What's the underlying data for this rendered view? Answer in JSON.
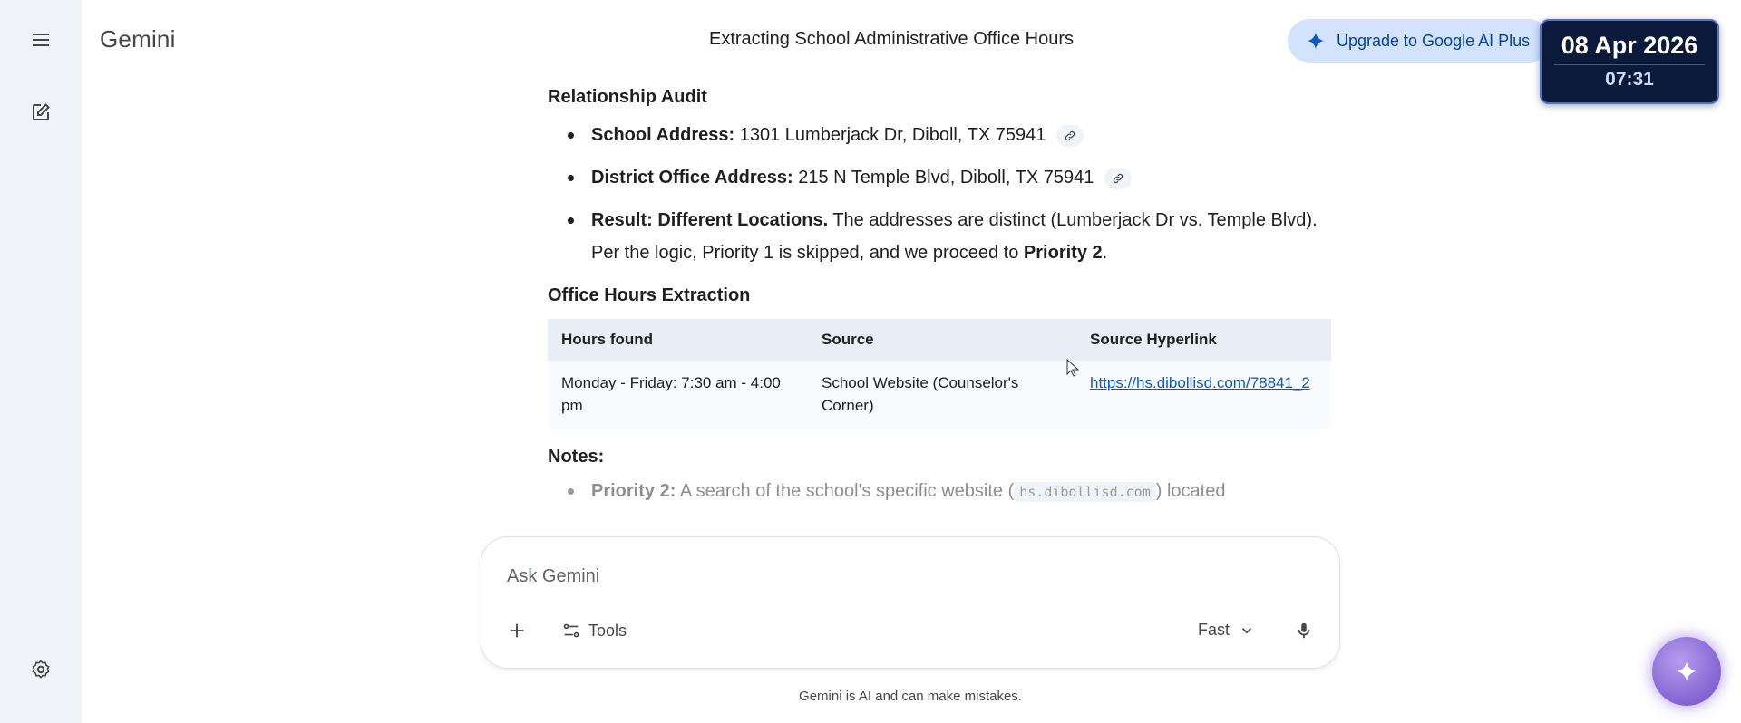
{
  "app": {
    "brand": "Gemini",
    "conversation_title": "Extracting School Administrative Office Hours"
  },
  "header": {
    "upgrade_label": "Upgrade to Google AI Plus"
  },
  "clock": {
    "date": "08 Apr 2026",
    "time": "07:31"
  },
  "sidebar": {
    "icons": [
      "menu-icon",
      "new-chat-icon",
      "settings-icon"
    ]
  },
  "relationship": {
    "heading": "Relationship Audit",
    "school_label": "School Address:",
    "school_value": "1301 Lumberjack Dr, Diboll, TX 75941",
    "district_label": "District Office Address:",
    "district_value": "215 N Temple Blvd, Diboll, TX 75941",
    "result_label": "Result: Different Locations.",
    "result_text": "The addresses are distinct (Lumberjack Dr vs. Temple Blvd). Per the logic, Priority 1 is skipped, and we proceed to",
    "result_emph": "Priority 2",
    "result_end": "."
  },
  "extraction": {
    "heading": "Office Hours Extraction",
    "columns": [
      "Hours found",
      "Source",
      "Source Hyperlink"
    ],
    "rows": [
      [
        "Monday - Friday: 7:30 am - 4:00 pm",
        "School Website (Counselor's Corner)",
        "https://hs.dibollisd.com/78841_2"
      ]
    ]
  },
  "notes": {
    "heading": "Notes:",
    "item_label": "Priority 2:",
    "item_text_before": "A search of the school's specific website (",
    "item_code": "hs.dibollisd.com",
    "item_text_after": ") located"
  },
  "prompt": {
    "placeholder": "Ask Gemini",
    "tools_label": "Tools",
    "mode_label": "Fast"
  },
  "footer": {
    "disclaimer": "Gemini is AI and can make mistakes."
  },
  "colors": {
    "sidebar_bg": "#f0f4f9",
    "upgrade_bg": "#d3e3fd",
    "link": "#0b57d0",
    "table_header": "#e9eef6"
  }
}
